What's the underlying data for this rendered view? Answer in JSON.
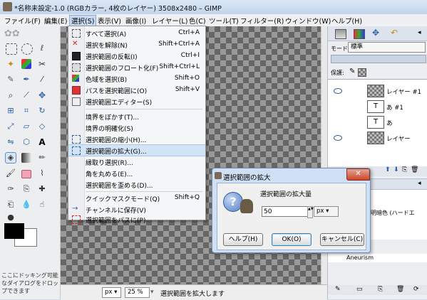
{
  "window": {
    "title": "*名称未設定-1.0 (RGBカラー, 4枚のレイヤー) 3508x2480 – GIMP"
  },
  "menubar": [
    "ファイル(F)",
    "編集(E)",
    "選択(S)",
    "表示(V)",
    "画像(I)",
    "レイヤー(L)",
    "色(C)",
    "ツール(T)",
    "フィルター(R)",
    "ウィンドウ(W)",
    "ヘルプ(H)"
  ],
  "toolbox": {
    "drop_hint": "ここにドッキング可能なダイアログをドロップできます"
  },
  "select_menu": {
    "items": [
      {
        "label": "すべて選択(A)",
        "shortcut": "Ctrl+A",
        "icon": "select-all-icon"
      },
      {
        "label": "選択を解除(N)",
        "shortcut": "Shift+Ctrl+A",
        "icon": "select-none-icon"
      },
      {
        "label": "選択範囲の反転(I)",
        "shortcut": "Ctrl+I",
        "icon": "invert-selection-icon"
      },
      {
        "label": "選択範囲のフロート化(F)",
        "shortcut": "Shift+Ctrl+L",
        "icon": "float-selection-icon"
      },
      {
        "label": "色域を選択(B)",
        "shortcut": "Shift+O",
        "icon": "select-by-color-icon"
      },
      {
        "label": "パスを選択範囲に(O)",
        "shortcut": "Shift+V",
        "icon": "path-to-selection-icon"
      },
      {
        "label": "選択範囲エディター(S)",
        "shortcut": "",
        "icon": "selection-editor-icon"
      },
      {
        "label": "境界をぼかす(T)...",
        "shortcut": "",
        "icon": ""
      },
      {
        "label": "境界の明確化(S)",
        "shortcut": "",
        "icon": ""
      },
      {
        "label": "選択範囲の縮小(H)...",
        "shortcut": "",
        "icon": "shrink-selection-icon"
      },
      {
        "label": "選択範囲の拡大(G)...",
        "shortcut": "",
        "icon": "grow-selection-icon"
      },
      {
        "label": "縁取り選択(R)...",
        "shortcut": "",
        "icon": ""
      },
      {
        "label": "角を丸める(E)...",
        "shortcut": "",
        "icon": ""
      },
      {
        "label": "選択範囲を歪める(D)...",
        "shortcut": "",
        "icon": ""
      },
      {
        "label": "クイックマスクモード(Q)",
        "shortcut": "Shift+Q",
        "icon": "quick-mask-icon"
      },
      {
        "label": "チャンネルに保存(V)",
        "shortcut": "",
        "icon": "save-to-channel-icon"
      },
      {
        "label": "選択範囲をパスに(P)",
        "shortcut": "",
        "icon": "selection-to-path-icon"
      }
    ]
  },
  "dialog": {
    "title": "選択範囲の拡大",
    "prompt": "選択範囲の拡大量",
    "value": "50",
    "unit": "px",
    "buttons": {
      "help": "ヘルプ(H)",
      "ok": "OK(O)",
      "cancel": "キャンセル(C)"
    }
  },
  "statusbar": {
    "unit": "px",
    "zoom": "25 %",
    "message": "選択範囲を拡大します"
  },
  "layers": {
    "mode_label": "モード:",
    "mode_value": "標準",
    "lock_label": "保護:",
    "rows": [
      {
        "name": "レイヤー #1",
        "visible": true
      },
      {
        "name": "あ #1",
        "visible": false
      },
      {
        "name": "あ",
        "visible": false
      },
      {
        "name": "レイヤー",
        "visible": true
      }
    ]
  },
  "brushes": {
    "item1": "明暗色 (ハードエ",
    "item2": "Aneurism"
  },
  "colors": {
    "accent": "#d4e4f7",
    "titlebar": "#c2d5ec",
    "close": "#c9482c"
  }
}
